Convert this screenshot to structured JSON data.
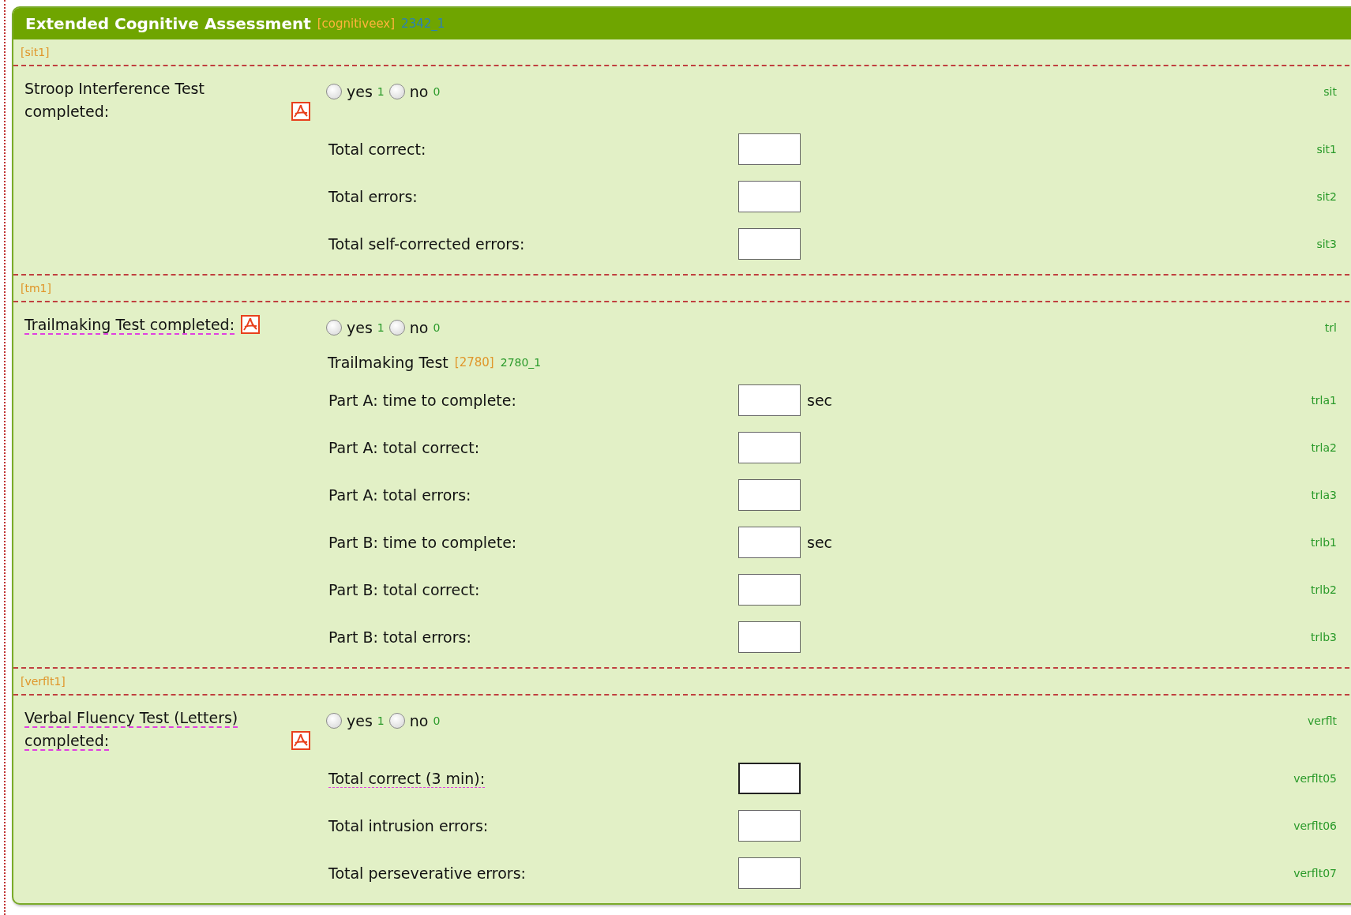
{
  "form": {
    "title": "Extended Cognitive Assessment",
    "table_code": "[cognitiveex]",
    "version": "2342_1"
  },
  "sections": [
    {
      "label": "[sit1]",
      "question": {
        "text": "Stroop Interference Test completed:",
        "annotated": false,
        "code": "sit",
        "options": [
          {
            "label": "yes",
            "code": "1",
            "selected": false
          },
          {
            "label": "no",
            "code": "0",
            "selected": false
          }
        ]
      },
      "items": [
        {
          "kind": "field",
          "label": "Total correct:",
          "code": "sit1",
          "annotated": false,
          "focused": false
        },
        {
          "kind": "field",
          "label": "Total errors:",
          "code": "sit2",
          "annotated": false,
          "focused": false
        },
        {
          "kind": "field",
          "label": "Total self-corrected errors:",
          "code": "sit3",
          "annotated": false,
          "focused": false
        }
      ]
    },
    {
      "label": "[tm1]",
      "question": {
        "text": "Trailmaking Test completed:",
        "annotated": true,
        "code": "trl",
        "options": [
          {
            "label": "yes",
            "code": "1",
            "selected": false
          },
          {
            "label": "no",
            "code": "0",
            "selected": false
          }
        ]
      },
      "items": [
        {
          "kind": "heading",
          "text": "Trailmaking Test",
          "table_code": "[2780]",
          "version": "2780_1"
        },
        {
          "kind": "field",
          "label": "Part A: time to complete:",
          "unit": "sec",
          "code": "trla1",
          "annotated": false,
          "focused": false
        },
        {
          "kind": "field",
          "label": "Part A: total correct:",
          "code": "trla2",
          "annotated": false,
          "focused": false
        },
        {
          "kind": "field",
          "label": "Part A: total errors:",
          "code": "trla3",
          "annotated": false,
          "focused": false
        },
        {
          "kind": "field",
          "label": "Part B: time to complete:",
          "unit": "sec",
          "code": "trlb1",
          "annotated": false,
          "focused": false
        },
        {
          "kind": "field",
          "label": "Part B: total correct:",
          "code": "trlb2",
          "annotated": false,
          "focused": false
        },
        {
          "kind": "field",
          "label": "Part B: total errors:",
          "code": "trlb3",
          "annotated": false,
          "focused": false
        }
      ]
    },
    {
      "label": "[verflt1]",
      "question": {
        "text": "Verbal Fluency Test (Letters) completed:",
        "annotated": true,
        "code": "verflt",
        "options": [
          {
            "label": "yes",
            "code": "1",
            "selected": false
          },
          {
            "label": "no",
            "code": "0",
            "selected": false
          }
        ]
      },
      "items": [
        {
          "kind": "field",
          "label": "Total correct (3 min):",
          "code": "verflt05",
          "annotated": true,
          "focused": true
        },
        {
          "kind": "field",
          "label": "Total intrusion errors:",
          "code": "verflt06",
          "annotated": false,
          "focused": false
        },
        {
          "kind": "field",
          "label": "Total perseverative errors:",
          "code": "verflt07",
          "annotated": false,
          "focused": false
        }
      ]
    }
  ]
}
